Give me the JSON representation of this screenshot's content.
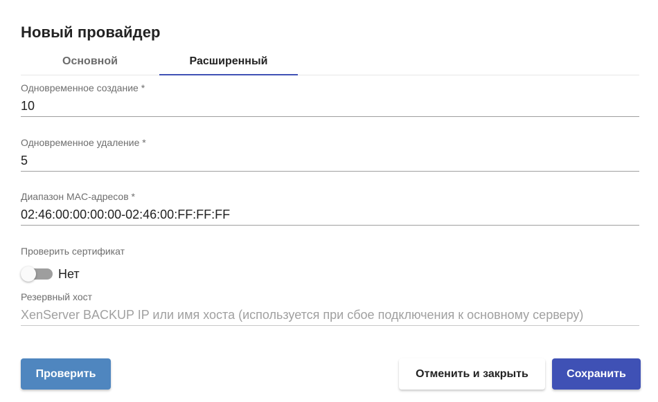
{
  "dialog": {
    "title": "Новый провайдер"
  },
  "tabs": [
    {
      "label": "Основной",
      "active": false
    },
    {
      "label": "Расширенный",
      "active": true
    }
  ],
  "fields": {
    "concurrent_creation": {
      "label": "Одновременное создание *",
      "value": "10"
    },
    "concurrent_removal": {
      "label": "Одновременное удаление *",
      "value": "5"
    },
    "mac_range": {
      "label": "Диапазон MAC-адресов *",
      "value": "02:46:00:00:00:00-02:46:00:FF:FF:FF"
    },
    "verify_cert": {
      "label": "Проверить сертификат",
      "state_label": "Нет",
      "checked": false
    },
    "backup_host": {
      "label": "Резервный хост",
      "value": "",
      "placeholder": "XenServer BACKUP IP или имя хоста (используется при сбое подключения к основному серверу)"
    }
  },
  "buttons": {
    "check": "Проверить",
    "cancel": "Отменить и закрыть",
    "save": "Сохранить"
  },
  "colors": {
    "accent": "#3f51b5",
    "check_button": "#4f86bf",
    "toggle_track": "#9e9e9e"
  }
}
